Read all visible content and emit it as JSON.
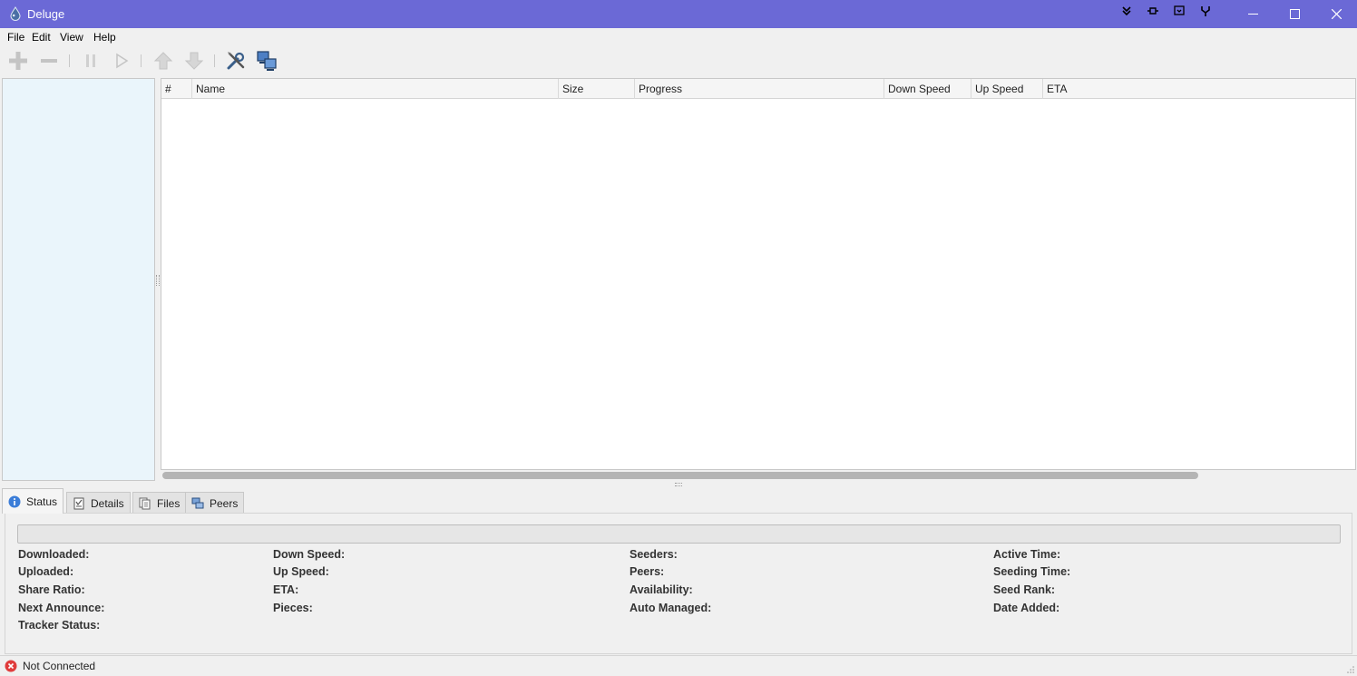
{
  "window": {
    "title": "Deluge",
    "accent_color": "#6b69d6",
    "controls": [
      "minimize-icon",
      "maximize-icon",
      "close-icon"
    ]
  },
  "menu": {
    "items": [
      "File",
      "Edit",
      "View",
      "Help"
    ]
  },
  "toolbar": {
    "buttons": [
      {
        "name": "add-torrent-button",
        "icon": "plus-icon",
        "enabled": false
      },
      {
        "name": "remove-torrent-button",
        "icon": "minus-icon",
        "enabled": false
      },
      {
        "name": "pause-button",
        "icon": "pause-icon",
        "enabled": false
      },
      {
        "name": "resume-button",
        "icon": "play-icon",
        "enabled": false
      },
      {
        "name": "queue-up-button",
        "icon": "arrow-up-icon",
        "enabled": false
      },
      {
        "name": "queue-down-button",
        "icon": "arrow-down-icon",
        "enabled": false
      },
      {
        "name": "preferences-button",
        "icon": "tools-icon",
        "enabled": true
      },
      {
        "name": "connection-manager-button",
        "icon": "network-icon",
        "enabled": true
      }
    ]
  },
  "torrents": {
    "columns": [
      "#",
      "Name",
      "Size",
      "Progress",
      "Down Speed",
      "Up Speed",
      "ETA"
    ],
    "rows": []
  },
  "details_tabs": [
    {
      "label": "Status",
      "icon": "info-icon",
      "active": true
    },
    {
      "label": "Details",
      "icon": "details-icon",
      "active": false
    },
    {
      "label": "Files",
      "icon": "files-icon",
      "active": false
    },
    {
      "label": "Peers",
      "icon": "peers-icon",
      "active": false
    }
  ],
  "status": {
    "progress": 0,
    "fields": [
      [
        "Downloaded:",
        "Uploaded:",
        "Share Ratio:",
        "Next Announce:",
        "Tracker Status:"
      ],
      [
        "Down Speed:",
        "Up Speed:",
        "ETA:",
        "Pieces:"
      ],
      [
        "Seeders:",
        "Peers:",
        "Availability:",
        "Auto Managed:"
      ],
      [
        "Active Time:",
        "Seeding Time:",
        "Seed Rank:",
        "Date Added:"
      ]
    ]
  },
  "statusbar": {
    "connection": "Not Connected",
    "icon": "error-icon",
    "icon_color": "#e03c3c"
  }
}
